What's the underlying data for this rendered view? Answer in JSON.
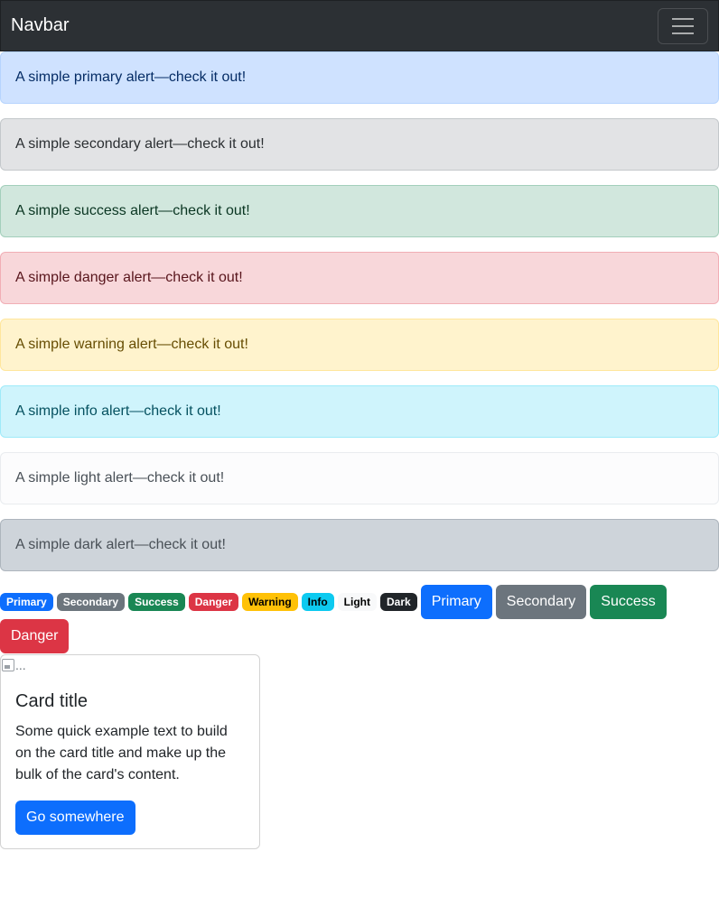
{
  "navbar": {
    "brand": "Navbar"
  },
  "alerts": [
    "A simple primary alert—check it out!",
    "A simple secondary alert—check it out!",
    "A simple success alert—check it out!",
    "A simple danger alert—check it out!",
    "A simple warning alert—check it out!",
    "A simple info alert—check it out!",
    "A simple light alert—check it out!",
    "A simple dark alert—check it out!"
  ],
  "badges": [
    "Primary",
    "Secondary",
    "Success",
    "Danger",
    "Warning",
    "Info",
    "Light",
    "Dark"
  ],
  "buttons": [
    "Primary",
    "Secondary",
    "Success",
    "Danger"
  ],
  "card": {
    "image_alt": "...",
    "title": "Card title",
    "text": "Some quick example text to build on the card title and make up the bulk of the card's content.",
    "button": "Go somewhere"
  },
  "colors": {
    "primary": "#0d6efd",
    "secondary": "#6c757d",
    "success": "#198754",
    "danger": "#dc3545",
    "warning": "#ffc107",
    "info": "#0dcaf0",
    "light": "#f8f9fa",
    "dark": "#212529",
    "navbar_bg": "#2c3034"
  }
}
